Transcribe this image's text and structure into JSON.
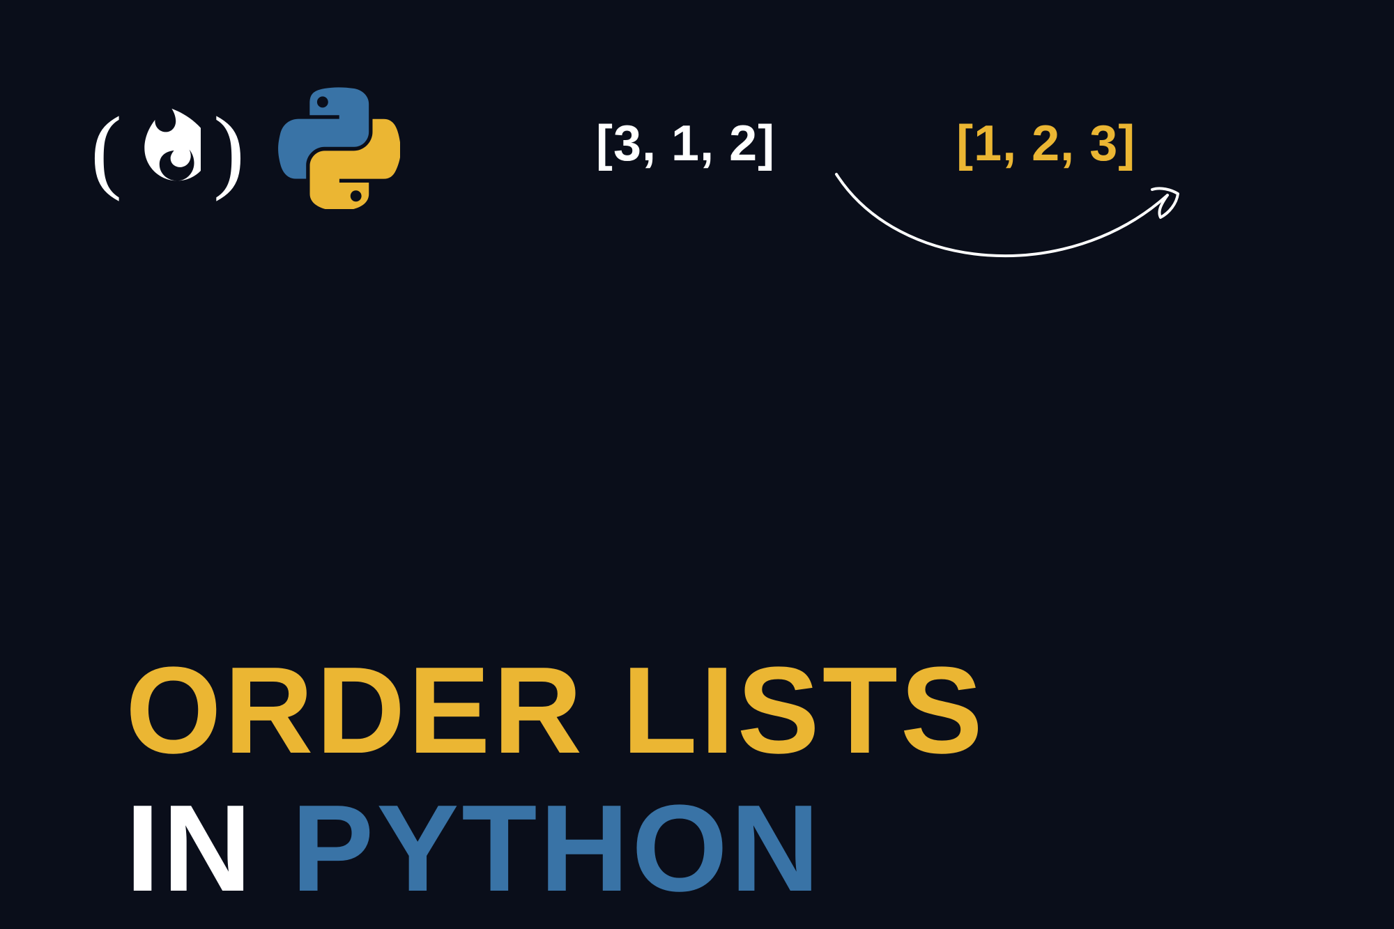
{
  "logos": {
    "fcc_left_paren": "(",
    "fcc_right_paren": ")",
    "fcc_icon": "flame-icon",
    "python_icon": "python-logo-icon"
  },
  "lists": {
    "unsorted": "[3, 1, 2]",
    "sorted": "[1, 2, 3]"
  },
  "title": {
    "line1": "ORDER LISTS",
    "line2_a": "IN",
    "line2_b": "PYTHON"
  },
  "colors": {
    "bg": "#0a0e1a",
    "gold": "#ebb633",
    "white": "#ffffff",
    "blue": "#3973a6",
    "python_blue": "#3973a6",
    "python_yellow": "#ebb633"
  }
}
